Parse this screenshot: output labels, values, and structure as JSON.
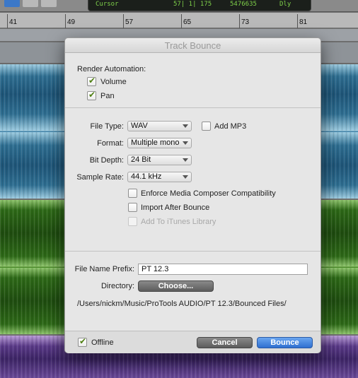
{
  "counter": {
    "label": "Cursor",
    "value1": "57| 1| 175",
    "value2": "5476635",
    "dly": "Dly"
  },
  "ruler": {
    "bars": [
      "41",
      "49",
      "57",
      "65",
      "73",
      "81"
    ]
  },
  "dialog": {
    "title": "Track Bounce",
    "render_automation": {
      "heading": "Render Automation:",
      "volume": {
        "label": "Volume",
        "checked": true
      },
      "pan": {
        "label": "Pan",
        "checked": true
      }
    },
    "file_type": {
      "label": "File Type:",
      "value": "WAV"
    },
    "add_mp3": {
      "label": "Add MP3",
      "checked": false
    },
    "format": {
      "label": "Format:",
      "value": "Multiple mono"
    },
    "bit_depth": {
      "label": "Bit Depth:",
      "value": "24 Bit"
    },
    "sample_rate": {
      "label": "Sample Rate:",
      "value": "44.1 kHz"
    },
    "options": [
      {
        "label": "Enforce Media Composer Compatibility",
        "checked": false,
        "disabled": false
      },
      {
        "label": "Import After Bounce",
        "checked": false,
        "disabled": false
      },
      {
        "label": "Add To iTunes Library",
        "checked": false,
        "disabled": true
      }
    ],
    "file_name_prefix": {
      "label": "File Name Prefix:",
      "value": "PT 12.3"
    },
    "directory": {
      "label": "Directory:",
      "button": "Choose...",
      "path": "/Users/nickm/Music/ProTools AUDIO/PT 12.3/Bounced Files/"
    },
    "offline": {
      "label": "Offline",
      "checked": true
    },
    "cancel_label": "Cancel",
    "bounce_label": "Bounce"
  },
  "colors": {
    "accent_blue": "#2f6fd0",
    "checkmark_green": "#4f7f12",
    "track_blue": "#3a80a8",
    "track_green": "#4a8a2a",
    "track_purple": "#5a3a88"
  }
}
